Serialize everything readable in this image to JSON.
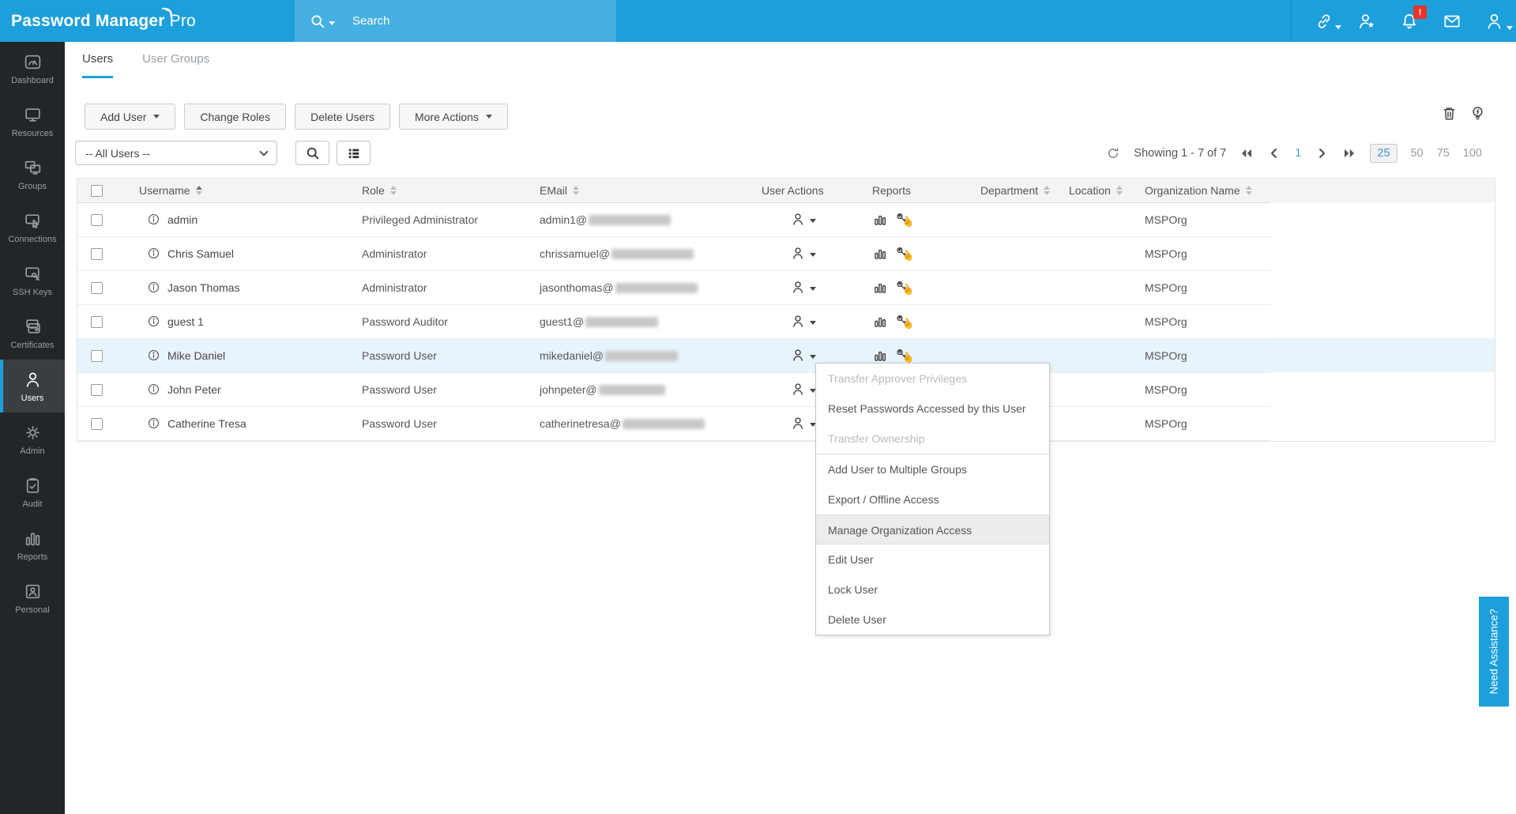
{
  "app": {
    "title_bold": "Password Manager",
    "title_light": "Pro"
  },
  "topbar": {
    "search_placeholder": "Search",
    "notification_badge": "!"
  },
  "sidebar": {
    "items": [
      {
        "label": "Dashboard",
        "active": false
      },
      {
        "label": "Resources",
        "active": false
      },
      {
        "label": "Groups",
        "active": false
      },
      {
        "label": "Connections",
        "active": false
      },
      {
        "label": "SSH Keys",
        "active": false
      },
      {
        "label": "Certificates",
        "active": false
      },
      {
        "label": "Users",
        "active": true
      },
      {
        "label": "Admin",
        "active": false
      },
      {
        "label": "Audit",
        "active": false
      },
      {
        "label": "Reports",
        "active": false
      },
      {
        "label": "Personal",
        "active": false
      }
    ]
  },
  "tabs": {
    "items": [
      {
        "label": "Users",
        "active": true
      },
      {
        "label": "User Groups",
        "active": false
      }
    ]
  },
  "toolbar": {
    "add_user": "Add User",
    "change_roles": "Change Roles",
    "delete_users": "Delete Users",
    "more_actions": "More Actions"
  },
  "filter": {
    "selected_option": "-- All Users --"
  },
  "pagination": {
    "showing": "Showing 1 - 7 of 7",
    "current_page": "1",
    "page_sizes": [
      "25",
      "50",
      "75",
      "100"
    ],
    "selected_page_size": "25"
  },
  "table": {
    "columns": [
      {
        "label": "Username",
        "sortable": true,
        "sorted": "asc"
      },
      {
        "label": "Role",
        "sortable": true
      },
      {
        "label": "EMail",
        "sortable": true
      },
      {
        "label": "User Actions",
        "sortable": false
      },
      {
        "label": "Reports",
        "sortable": false
      },
      {
        "label": "Department",
        "sortable": true
      },
      {
        "label": "Location",
        "sortable": true
      },
      {
        "label": "Organization Name",
        "sortable": true
      }
    ],
    "rows": [
      {
        "username": "admin",
        "role": "Privileged Administrator",
        "email_prefix": "admin1@",
        "email_domain_redacted": true,
        "department": "",
        "location": "",
        "organization": "MSPOrg"
      },
      {
        "username": "Chris Samuel",
        "role": "Administrator",
        "email_prefix": "chrissamuel@",
        "email_domain_redacted": true,
        "department": "",
        "location": "",
        "organization": "MSPOrg"
      },
      {
        "username": "Jason Thomas",
        "role": "Administrator",
        "email_prefix": "jasonthomas@",
        "email_domain_redacted": true,
        "department": "",
        "location": "",
        "organization": "MSPOrg"
      },
      {
        "username": "guest 1",
        "role": "Password Auditor",
        "email_prefix": "guest1@",
        "email_domain_redacted": true,
        "department": "",
        "location": "",
        "organization": "MSPOrg"
      },
      {
        "username": "Mike Daniel",
        "role": "Password User",
        "email_prefix": "mikedaniel@",
        "email_domain_redacted": true,
        "department": "",
        "location": "",
        "organization": "MSPOrg",
        "highlighted": true
      },
      {
        "username": "John Peter",
        "role": "Password User",
        "email_prefix": "johnpeter@",
        "email_domain_redacted": true,
        "department": "",
        "location": "",
        "organization": "MSPOrg"
      },
      {
        "username": "Catherine Tresa",
        "role": "Password User",
        "email_prefix": "catherinetresa@",
        "email_domain_redacted": true,
        "department": "",
        "location": "",
        "organization": "MSPOrg"
      }
    ]
  },
  "context_menu": {
    "items": [
      {
        "label": "Transfer Approver Privileges",
        "disabled": true
      },
      {
        "label": "Reset Passwords Accessed by this User",
        "disabled": false
      },
      {
        "label": "Transfer Ownership",
        "disabled": true
      },
      {
        "label": "Add User to Multiple Groups",
        "disabled": false
      },
      {
        "label": "Export / Offline Access",
        "disabled": false
      },
      {
        "label": "Manage Organization Access",
        "disabled": false,
        "highlighted": true
      },
      {
        "label": "Edit User",
        "disabled": false
      },
      {
        "label": "Lock User",
        "disabled": false
      },
      {
        "label": "Delete User",
        "disabled": false
      }
    ]
  },
  "help_tab": {
    "label": "Need Assistance?"
  },
  "colors": {
    "brand_blue": "#1C9FDB",
    "notification_red": "#E8332A",
    "row_highlight": "#E7F4FC"
  }
}
